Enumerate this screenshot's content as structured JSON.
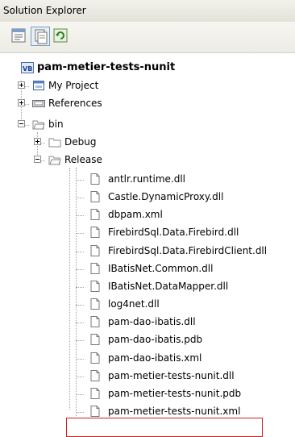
{
  "window": {
    "title": "Solution Explorer"
  },
  "toolbar": {
    "buttons": [
      {
        "icon": "properties-icon"
      },
      {
        "icon": "show-all-files-icon",
        "pressed": true
      },
      {
        "icon": "refresh-icon"
      }
    ]
  },
  "tree": {
    "project": "pam-metier-tests-nunit",
    "my_project": "My Project",
    "references": "References",
    "bin": "bin",
    "debug": "Debug",
    "release": "Release",
    "files": [
      "antlr.runtime.dll",
      "Castle.DynamicProxy.dll",
      "dbpam.xml",
      "FirebirdSql.Data.Firebird.dll",
      "FirebirdSql.Data.FirebirdClient.dll",
      "IBatisNet.Common.dll",
      "IBatisNet.DataMapper.dll",
      "log4net.dll",
      "pam-dao-ibatis.dll",
      "pam-dao-ibatis.pdb",
      "pam-dao-ibatis.xml",
      "pam-metier-tests-nunit.dll",
      "pam-metier-tests-nunit.pdb",
      "pam-metier-tests-nunit.xml"
    ],
    "highlighted_file": "pam-metier-tests-nunit.dll"
  }
}
